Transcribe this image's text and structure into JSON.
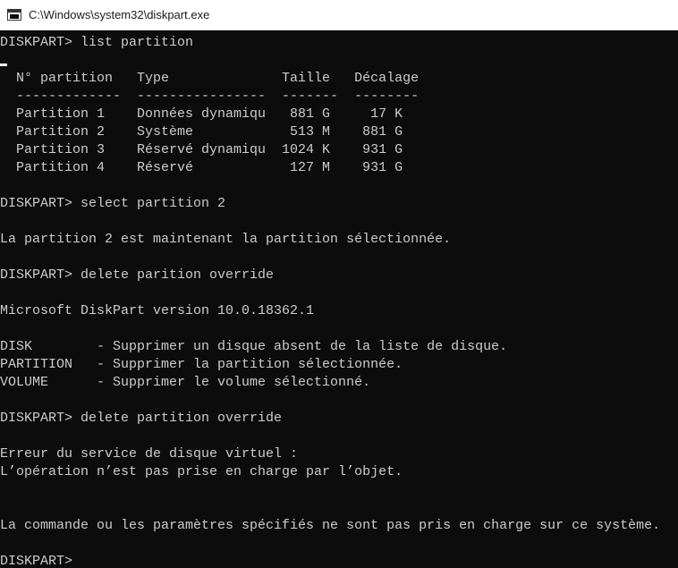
{
  "window": {
    "title": "C:\\Windows\\system32\\diskpart.exe",
    "icon": "console-window-icon"
  },
  "console": {
    "lines": [
      "DISKPART> list partition",
      "",
      "  N° partition   Type              Taille   Décalage",
      "  -------------  ----------------  -------  --------",
      "  Partition 1    Données dynamiqu   881 G     17 K",
      "  Partition 2    Système            513 M    881 G",
      "  Partition 3    Réservé dynamiqu  1024 K    931 G",
      "  Partition 4    Réservé            127 M    931 G",
      "",
      "DISKPART> select partition 2",
      "",
      "La partition 2 est maintenant la partition sélectionnée.",
      "",
      "DISKPART> delete parition override",
      "",
      "Microsoft DiskPart version 10.0.18362.1",
      "",
      "DISK        - Supprimer un disque absent de la liste de disque.",
      "PARTITION   - Supprimer la partition sélectionnée.",
      "VOLUME      - Supprimer le volume sélectionné.",
      "",
      "DISKPART> delete partition override",
      "",
      "Erreur du service de disque virtuel :",
      "L’opération n’est pas prise en charge par l’objet.",
      "",
      "",
      "La commande ou les paramètres spécifiés ne sont pas pris en charge sur ce système.",
      "",
      "DISKPART> "
    ]
  },
  "colors": {
    "background": "#0c0c0c",
    "text": "#cccccc",
    "titlebar": "#ffffff"
  }
}
